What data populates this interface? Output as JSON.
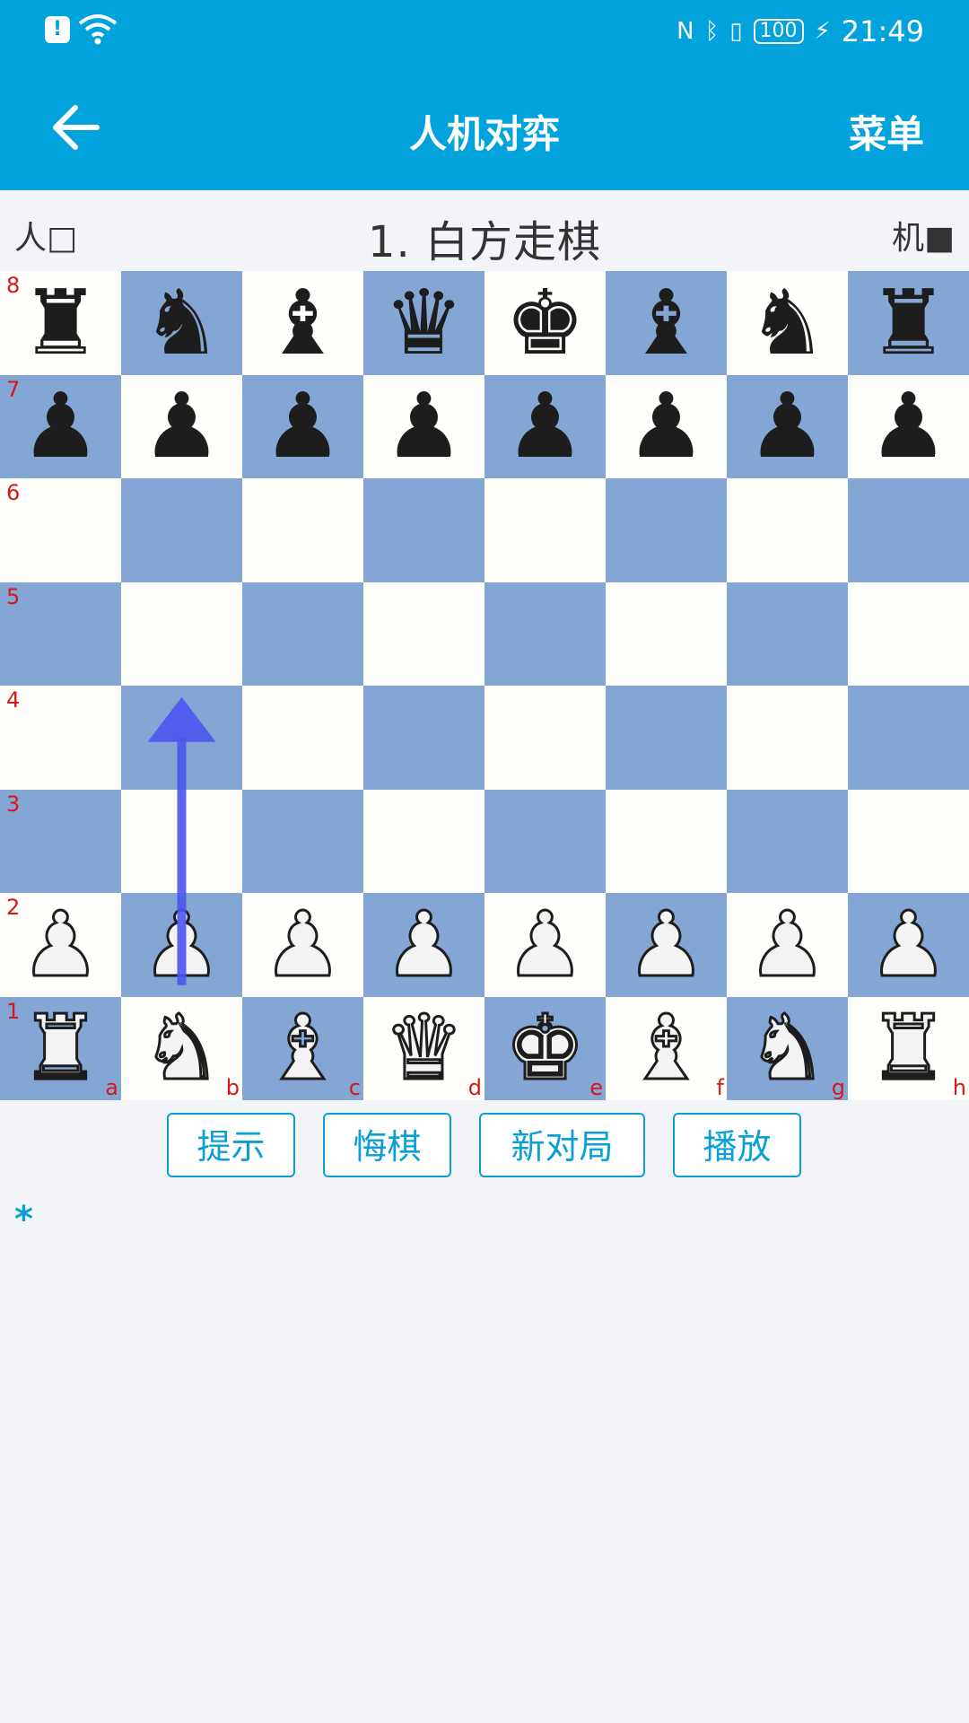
{
  "status_bar": {
    "notification_icon": "!",
    "nfc_icon": "N",
    "battery": "100",
    "time": "21:49"
  },
  "app_bar": {
    "back_icon": "arrow-left",
    "title": "人机对弈",
    "menu_label": "菜单"
  },
  "info_bar": {
    "human": "人□",
    "turn": "1. 白方走棋",
    "ai": "机■"
  },
  "colors": {
    "accent": "#02a3dd",
    "light_square": "#fefefb",
    "dark_square": "#84a6d4",
    "coord": "#d81818",
    "arrow": "#4a55f0"
  },
  "board": {
    "files": [
      "a",
      "b",
      "c",
      "d",
      "e",
      "f",
      "g",
      "h"
    ],
    "ranks": [
      "8",
      "7",
      "6",
      "5",
      "4",
      "3",
      "2",
      "1"
    ],
    "rows": [
      [
        "bR",
        "bN",
        "bB",
        "bQ",
        "bK",
        "bB",
        "bN",
        "bR"
      ],
      [
        "bP",
        "bP",
        "bP",
        "bP",
        "bP",
        "bP",
        "bP",
        "bP"
      ],
      [
        "",
        "",
        "",
        "",
        "",
        "",
        "",
        ""
      ],
      [
        "",
        "",
        "",
        "",
        "",
        "",
        "",
        ""
      ],
      [
        "",
        "",
        "",
        "",
        "",
        "",
        "",
        ""
      ],
      [
        "",
        "",
        "",
        "",
        "",
        "",
        "",
        ""
      ],
      [
        "wP",
        "wP",
        "wP",
        "wP",
        "wP",
        "wP",
        "wP",
        "wP"
      ],
      [
        "wR",
        "wN",
        "wB",
        "wQ",
        "wK",
        "wB",
        "wN",
        "wR"
      ]
    ],
    "hint_arrow": {
      "from": "b2",
      "to": "b4"
    }
  },
  "controls": {
    "hint": "提示",
    "undo": "悔棋",
    "new_game": "新对局",
    "play": "播放"
  },
  "move_list": "*"
}
